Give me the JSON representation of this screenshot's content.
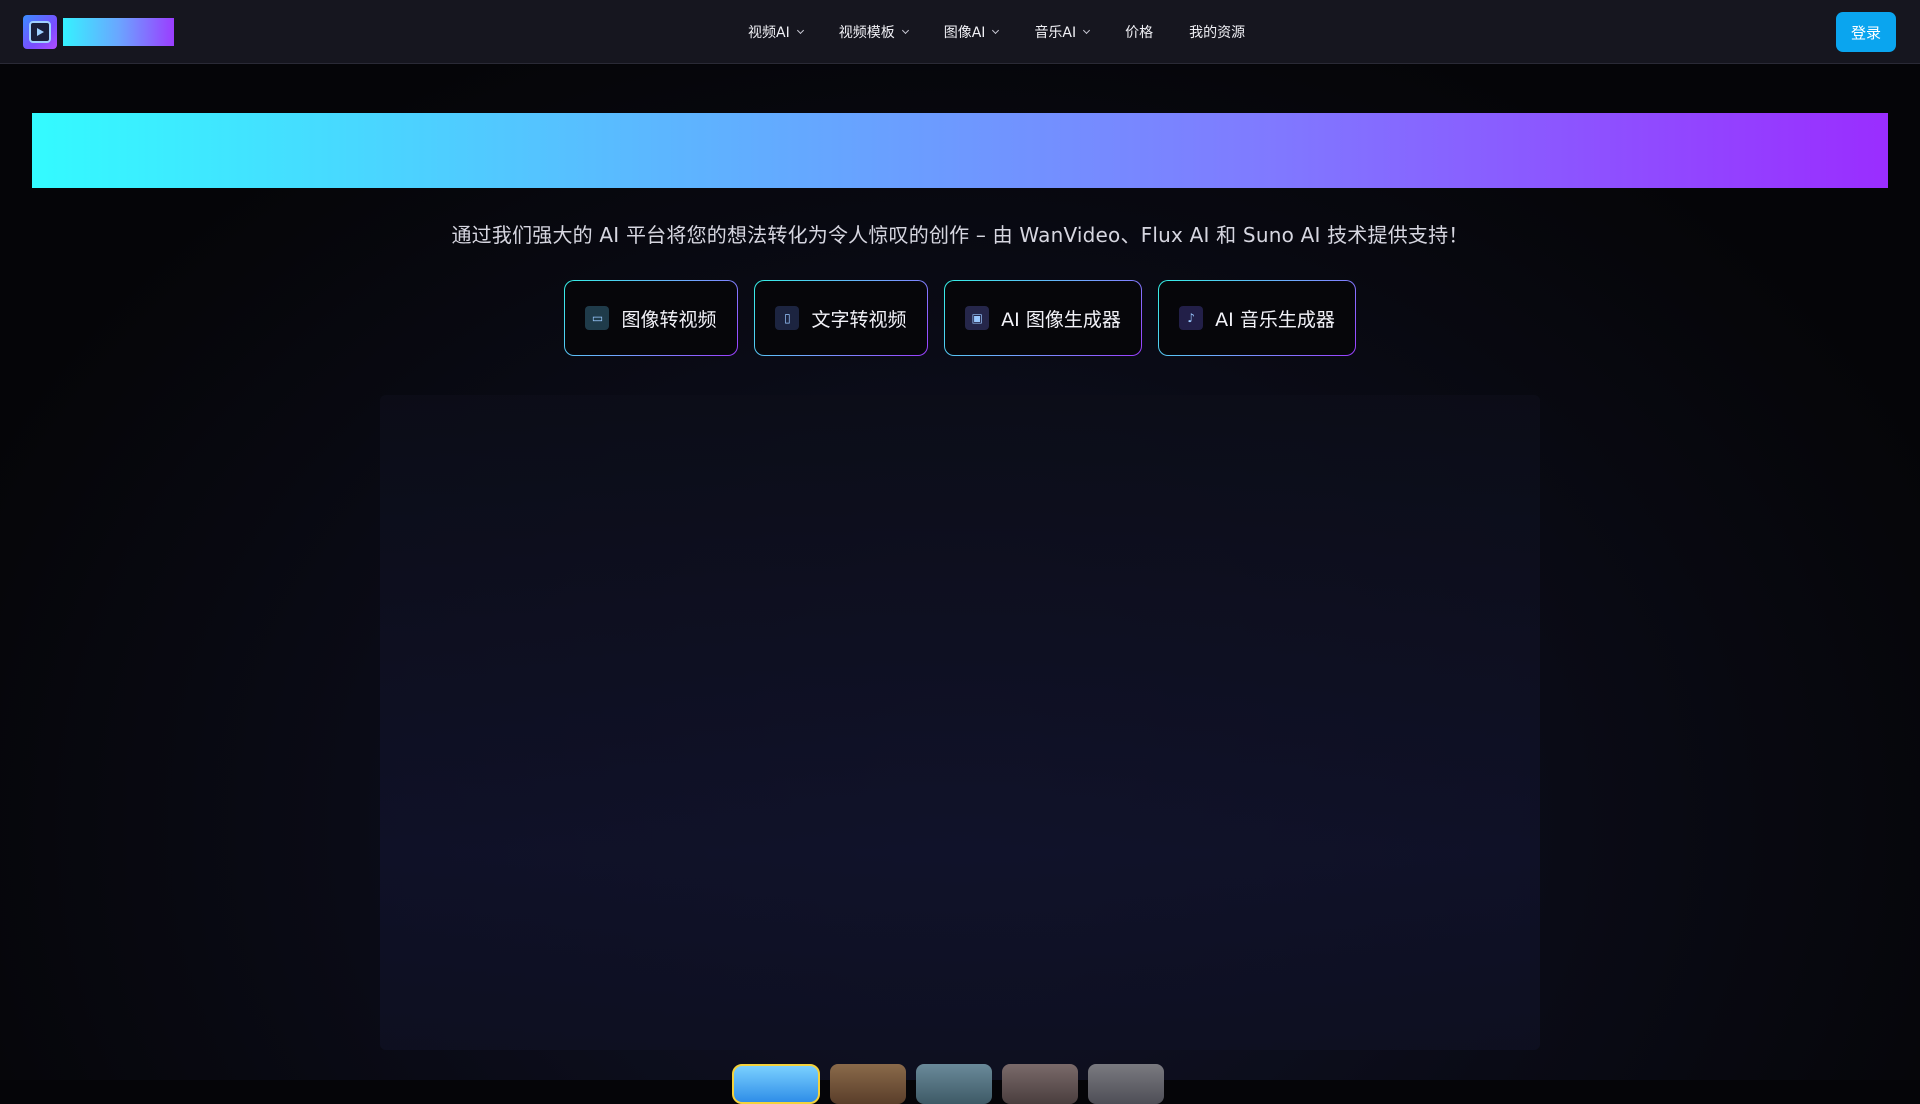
{
  "header": {
    "logo_icon": "play-icon",
    "nav": [
      {
        "label": "视频AI",
        "dropdown": true
      },
      {
        "label": "视频模板",
        "dropdown": true
      },
      {
        "label": "图像AI",
        "dropdown": true
      },
      {
        "label": "音乐AI",
        "dropdown": true
      },
      {
        "label": "价格",
        "dropdown": false
      },
      {
        "label": "我的资源",
        "dropdown": false
      }
    ],
    "login_label": "登录"
  },
  "hero": {
    "subtitle": "通过我们强大的 AI 平台将您的想法转化为令人惊叹的创作 – 由 WanVideo、Flux AI 和 Suno AI 技术提供支持！"
  },
  "features": [
    {
      "label": "图像转视频",
      "icon": "image-to-video-icon"
    },
    {
      "label": "文字转视频",
      "icon": "text-to-video-icon"
    },
    {
      "label": "AI 图像生成器",
      "icon": "image-generator-icon"
    },
    {
      "label": "AI 音乐生成器",
      "icon": "music-generator-icon"
    }
  ],
  "colors": {
    "accent": "#0aa5ef",
    "gradient_start": "#33fbff",
    "gradient_end": "#9a2dff",
    "active_thumb_border": "#f4d23c"
  }
}
